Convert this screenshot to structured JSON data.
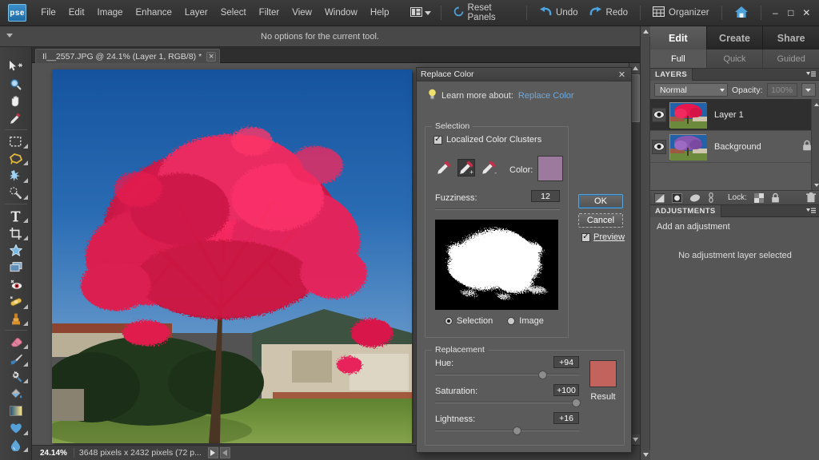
{
  "app": {
    "logo_text": "pse",
    "menus": [
      "File",
      "Edit",
      "Image",
      "Enhance",
      "Layer",
      "Select",
      "Filter",
      "View",
      "Window",
      "Help"
    ],
    "layout_icon": "layout-grid-icon",
    "actions": [
      {
        "label": "Reset Panels",
        "icon": "reset-icon"
      },
      {
        "label": "Undo",
        "icon": "undo-arrow-icon"
      },
      {
        "label": "Redo",
        "icon": "redo-arrow-icon"
      },
      {
        "label": "Organizer",
        "icon": "organizer-grid-icon"
      }
    ],
    "home_icon": "home-icon",
    "window_buttons": [
      {
        "name": "minimize-button",
        "glyph": "–"
      },
      {
        "name": "maximize-button",
        "glyph": "□"
      },
      {
        "name": "close-button",
        "glyph": "✕"
      }
    ]
  },
  "options_bar": {
    "text": "No options for the current tool."
  },
  "toolbox": {
    "groups": [
      [
        {
          "name": "move-tool",
          "icon": "move-cursor-icon",
          "has_flyout": false
        },
        {
          "name": "zoom-tool",
          "icon": "magnifier-icon",
          "has_flyout": false
        },
        {
          "name": "hand-tool",
          "icon": "hand-icon",
          "has_flyout": false
        },
        {
          "name": "eyedropper-tool",
          "icon": "eyedropper-icon",
          "has_flyout": false
        }
      ],
      [
        {
          "name": "marquee-tool",
          "icon": "rect-marquee-icon",
          "has_flyout": true
        },
        {
          "name": "lasso-tool",
          "icon": "polygon-lasso-icon",
          "has_flyout": true
        },
        {
          "name": "magic-wand-tool",
          "icon": "magic-wand-sparkle-icon",
          "has_flyout": true
        },
        {
          "name": "selection-brush-tool",
          "icon": "selection-brush-icon",
          "has_flyout": true
        }
      ],
      [
        {
          "name": "type-tool",
          "icon": "text-t-icon",
          "has_flyout": true
        },
        {
          "name": "crop-tool",
          "icon": "crop-icon",
          "has_flyout": true
        },
        {
          "name": "cookie-cutter-tool",
          "icon": "star-shape-icon",
          "has_flyout": false
        },
        {
          "name": "straighten-tool",
          "icon": "straighten-layers-icon",
          "has_flyout": false
        },
        {
          "name": "red-eye-tool",
          "icon": "red-eye-icon",
          "has_flyout": false
        },
        {
          "name": "healing-brush-tool",
          "icon": "healing-bandage-icon",
          "has_flyout": true
        },
        {
          "name": "clone-stamp-tool",
          "icon": "clone-stamp-icon",
          "has_flyout": true
        }
      ],
      [
        {
          "name": "eraser-tool",
          "icon": "eraser-icon",
          "has_flyout": true
        },
        {
          "name": "brush-tool",
          "icon": "paintbrush-icon",
          "has_flyout": true
        },
        {
          "name": "smart-brush-tool",
          "icon": "smart-brush-gear-icon",
          "has_flyout": true
        },
        {
          "name": "paint-bucket-tool",
          "icon": "paint-bucket-icon",
          "has_flyout": false
        },
        {
          "name": "gradient-tool",
          "icon": "gradient-icon",
          "has_flyout": false
        },
        {
          "name": "shape-tool",
          "icon": "heart-shape-icon",
          "has_flyout": true
        },
        {
          "name": "blur-tool",
          "icon": "water-drop-icon",
          "has_flyout": true
        }
      ]
    ]
  },
  "document": {
    "tab_title": "Il__2557.JPG @ 24.1% (Layer 1, RGB/8) *",
    "close_glyph": "×"
  },
  "status_bar": {
    "zoom": "24.14%",
    "dimensions": "3648 pixels x 2432 pixels (72 p...",
    "play_glyph": "▶",
    "nav_glyph": "◂"
  },
  "panel_bin": {
    "main_tabs": [
      {
        "label": "Edit",
        "active": true
      },
      {
        "label": "Create",
        "active": false
      },
      {
        "label": "Share",
        "active": false
      }
    ],
    "sub_tabs": [
      {
        "label": "Full",
        "active": true
      },
      {
        "label": "Quick",
        "active": false
      },
      {
        "label": "Guided",
        "active": false
      }
    ],
    "layers": {
      "panel_title": "LAYERS",
      "blend_mode": "Normal",
      "opacity_label": "Opacity:",
      "opacity_value": "100%",
      "rows": [
        {
          "name": "Layer 1",
          "selected": true,
          "visible": true,
          "locked": false,
          "thumb": "red-tree"
        },
        {
          "name": "Background",
          "selected": false,
          "visible": true,
          "locked": true,
          "thumb": "purple-tree"
        }
      ],
      "toolbar_icons": [
        "new-layer-icon",
        "adjustment-layer-icon",
        "layer-mask-icon",
        "link-layers-icon"
      ],
      "lock_label": "Lock:",
      "lock_icons": [
        "lock-transparency-icon",
        "lock-all-icon"
      ],
      "trash_icon": "trash-icon"
    },
    "adjustments": {
      "panel_title": "ADJUSTMENTS",
      "add_text": "Add an adjustment",
      "empty_text": "No adjustment layer selected"
    }
  },
  "dialog": {
    "title": "Replace Color",
    "close_glyph": "✕",
    "learn_prefix": "Learn more about:",
    "learn_link": "Replace Color",
    "bulb_icon": "lightbulb-icon",
    "selection": {
      "group_label": "Selection",
      "localized_label": "Localized Color Clusters",
      "localized_checked": true,
      "droppers": [
        {
          "name": "eyedropper-sample",
          "active": false,
          "modifier": ""
        },
        {
          "name": "eyedropper-add",
          "active": true,
          "modifier": "+"
        },
        {
          "name": "eyedropper-subtract",
          "active": false,
          "modifier": "-"
        }
      ],
      "color_label": "Color:",
      "color_swatch": "#9b7a9e",
      "fuzziness_label": "Fuzziness:",
      "fuzziness_value": "12",
      "fuzziness_percent": 8,
      "view_options": [
        {
          "label": "Selection",
          "selected": true
        },
        {
          "label": "Image",
          "selected": false
        }
      ]
    },
    "replacement": {
      "group_label": "Replacement",
      "sliders": [
        {
          "label": "Hue:",
          "value": "+94",
          "percent": 74
        },
        {
          "label": "Saturation:",
          "value": "+100",
          "percent": 98
        },
        {
          "label": "Lightness:",
          "value": "+16",
          "percent": 56
        }
      ],
      "result_label": "Result",
      "result_swatch": "#c2635e"
    },
    "buttons": {
      "ok": "OK",
      "cancel": "Cancel",
      "preview_label": "Preview",
      "preview_checked": true
    }
  },
  "colors": {
    "sky": "#1e5fa8",
    "blossom": "#e81a4e",
    "lawn": "#6f8f3a",
    "house": "#cdc3ad",
    "accent_blue": "#6fa8dc"
  }
}
